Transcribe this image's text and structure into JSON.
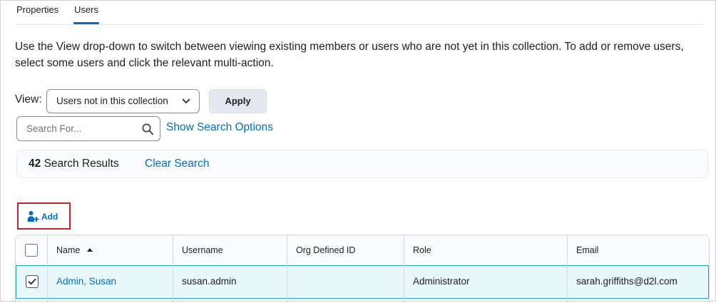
{
  "tabs": [
    {
      "label": "Properties",
      "active": false
    },
    {
      "label": "Users",
      "active": true
    }
  ],
  "description": "Use the View drop-down to switch between viewing existing members or users who are not yet in this collection. To add or remove users, select some users and click the relevant multi-action.",
  "view": {
    "label": "View:",
    "selected": "Users not in this collection",
    "apply_label": "Apply"
  },
  "search": {
    "placeholder": "Search For...",
    "options_link": "Show Search Options"
  },
  "results": {
    "count": "42",
    "label": "Search Results",
    "clear_label": "Clear Search"
  },
  "actions": {
    "add_label": "Add",
    "add_icon": "add-user-icon"
  },
  "table": {
    "columns": [
      "Name",
      "Username",
      "Org Defined ID",
      "Role",
      "Email"
    ],
    "sort_icon": "sort-ascending-icon",
    "rows": [
      {
        "name": "Admin, Susan",
        "username": "susan.admin",
        "org_id": "",
        "role": "Administrator",
        "email": "sarah.griffiths@d2l.com",
        "selected": true
      }
    ]
  },
  "colors": {
    "link": "#006fbf",
    "selected_row_bg": "#e8f8fa",
    "selected_row_border": "#2aa2c1",
    "highlight_box": "#c0262d"
  }
}
